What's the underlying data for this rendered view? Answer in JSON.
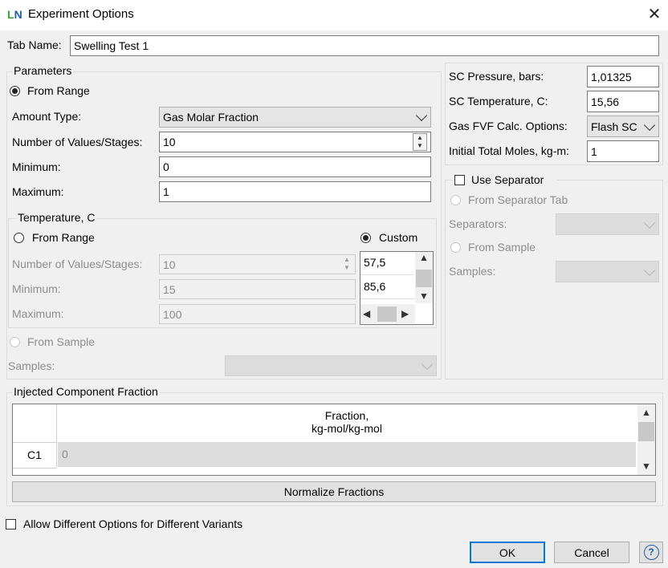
{
  "window": {
    "title": "Experiment Options",
    "icon_letters_1": "L",
    "icon_letters_2": "N",
    "close": "✕"
  },
  "tab_name": {
    "label": "Tab Name:",
    "value": "Swelling Test 1"
  },
  "parameters": {
    "group_label": "Parameters",
    "from_range_label": "From Range",
    "amount_type_label": "Amount Type:",
    "amount_type_value": "Gas Molar Fraction",
    "num_values_label": "Number of Values/Stages:",
    "num_values_value": "10",
    "minimum_label": "Minimum:",
    "minimum_value": "0",
    "maximum_label": "Maximum:",
    "maximum_value": "1"
  },
  "temperature": {
    "group_label": "Temperature, C",
    "from_range_label": "From Range",
    "custom_label": "Custom",
    "num_values_label": "Number of Values/Stages:",
    "num_values_value": "10",
    "minimum_label": "Minimum:",
    "minimum_value": "15",
    "maximum_label": "Maximum:",
    "maximum_value": "100",
    "custom_values": [
      "57,5",
      "85,6"
    ]
  },
  "from_sample": {
    "label": "From Sample",
    "samples_label": "Samples:"
  },
  "sc": {
    "pressure_label": "SC Pressure, bars:",
    "pressure_value": "1,01325",
    "temperature_label": "SC Temperature, C:",
    "temperature_value": "15,56",
    "fvf_label": "Gas FVF Calc. Options:",
    "fvf_value": "Flash SC",
    "moles_label": "Initial Total Moles, kg-m:",
    "moles_value": "1"
  },
  "separator": {
    "use_label": "Use Separator",
    "from_tab_label": "From Separator Tab",
    "separators_label": "Separators:",
    "from_sample_label": "From Sample",
    "samples_label": "Samples:"
  },
  "injected": {
    "group_label": "Injected Component Fraction",
    "header_line1": "Fraction,",
    "header_line2": "kg-mol/kg-mol",
    "row_label": "C1",
    "row_value": "0",
    "normalize_label": "Normalize Fractions"
  },
  "allow_label": "Allow Different Options for Different Variants",
  "buttons": {
    "ok": "OK",
    "cancel": "Cancel",
    "help": "?"
  }
}
